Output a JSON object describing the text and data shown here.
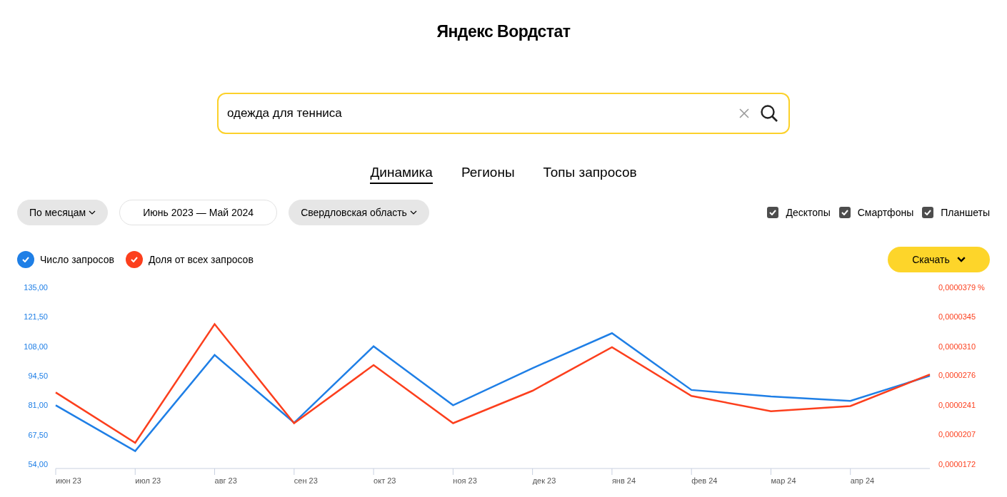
{
  "header": {
    "title": "Яндекс Вордстат"
  },
  "search": {
    "value": "одежда для тенниса"
  },
  "tabs": [
    {
      "label": "Динамика",
      "selected": true
    },
    {
      "label": "Регионы",
      "selected": false
    },
    {
      "label": "Топы запросов",
      "selected": false
    }
  ],
  "filters": [
    {
      "kind": "dropdown",
      "label": "По месяцам"
    },
    {
      "kind": "range",
      "label": "Июнь 2023 — Май 2024"
    },
    {
      "kind": "dropdown",
      "label": "Свердловская область"
    }
  ],
  "devices": [
    {
      "label": "Десктопы",
      "checked": true
    },
    {
      "label": "Смартфоны",
      "checked": true
    },
    {
      "label": "Планшеты",
      "checked": true
    }
  ],
  "legend": [
    {
      "checked": true
    },
    {
      "checked": true
    }
  ],
  "download_button": {
    "label": "Скачать"
  },
  "charts": [
    {
      "chart_data": {
        "type": "line",
        "categories": [
          "июн 23",
          "июл 23",
          "авг 23",
          "сен 23",
          "окт 23",
          "ноя 23",
          "дек 23",
          "янв 24",
          "фев 24",
          "мар 24",
          "апр 24",
          null
        ],
        "ylim": [
          54,
          135
        ],
        "yticks": [
          {
            "value": 135,
            "label": "135,00"
          },
          {
            "value": 121.5,
            "label": "121,50"
          },
          {
            "value": 108,
            "label": "108,00"
          },
          {
            "value": 94.5,
            "label": "94,50"
          },
          {
            "value": 81,
            "label": "81,00"
          },
          {
            "value": 67.5,
            "label": "67,50"
          },
          {
            "value": 54,
            "label": "54,00"
          }
        ],
        "series": [
          {
            "name": "Число запросов",
            "color": "#1f7fe6",
            "values": [
              81,
              60,
              104,
              73,
              108,
              81,
              98,
              114,
              88,
              85,
              83,
              94.5
            ]
          }
        ]
      }
    },
    {
      "chart_data": {
        "type": "line",
        "ylim": [
          1.72e-05,
          3.79e-05
        ],
        "yticks": [
          {
            "value": 3.79e-05,
            "label": "0,0000379 %"
          },
          {
            "value": 3.45e-05,
            "label": "0,0000345"
          },
          {
            "value": 3.1e-05,
            "label": "0,0000310"
          },
          {
            "value": 2.76e-05,
            "label": "0,0000276"
          },
          {
            "value": 2.41e-05,
            "label": "0,0000241"
          },
          {
            "value": 2.07e-05,
            "label": "0,0000207"
          },
          {
            "value": 1.72e-05,
            "label": "0,0000172"
          }
        ],
        "series": [
          {
            "name": "Доля от всех запросов",
            "color": "#fc3f1d",
            "values": [
              2.56e-05,
              1.97e-05,
              3.36e-05,
              2.2e-05,
              2.88e-05,
              2.2e-05,
              2.58e-05,
              3.09e-05,
              2.52e-05,
              2.34e-05,
              2.4e-05,
              2.77e-05
            ]
          }
        ]
      }
    }
  ]
}
